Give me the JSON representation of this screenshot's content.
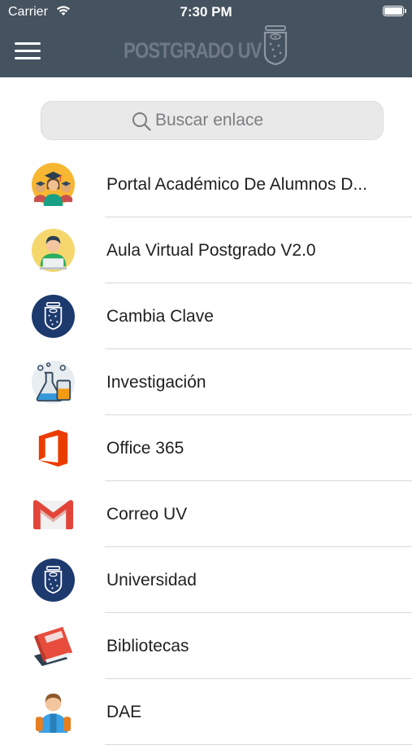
{
  "status_bar": {
    "carrier": "Carrier",
    "time": "7:30 PM"
  },
  "header": {
    "brand": "POSTGRADO UV",
    "menu_icon": "hamburger-menu-icon"
  },
  "search": {
    "placeholder": "Buscar enlace"
  },
  "colors": {
    "header_bg": "#45525f",
    "uv_blue": "#1d3a6e",
    "separator": "#d9d9d9"
  },
  "links": [
    {
      "label": "Portal Académico De Alumnos D...",
      "icon": "graduates-icon"
    },
    {
      "label": "Aula Virtual Postgrado V2.0",
      "icon": "student-laptop-icon"
    },
    {
      "label": "Cambia Clave",
      "icon": "uv-shield-icon"
    },
    {
      "label": "Investigación",
      "icon": "lab-flask-icon"
    },
    {
      "label": "Office 365",
      "icon": "office-icon"
    },
    {
      "label": "Correo UV",
      "icon": "gmail-icon"
    },
    {
      "label": "Universidad",
      "icon": "uv-shield-icon"
    },
    {
      "label": "Bibliotecas",
      "icon": "books-icon"
    },
    {
      "label": "DAE",
      "icon": "student-backpack-icon"
    }
  ]
}
